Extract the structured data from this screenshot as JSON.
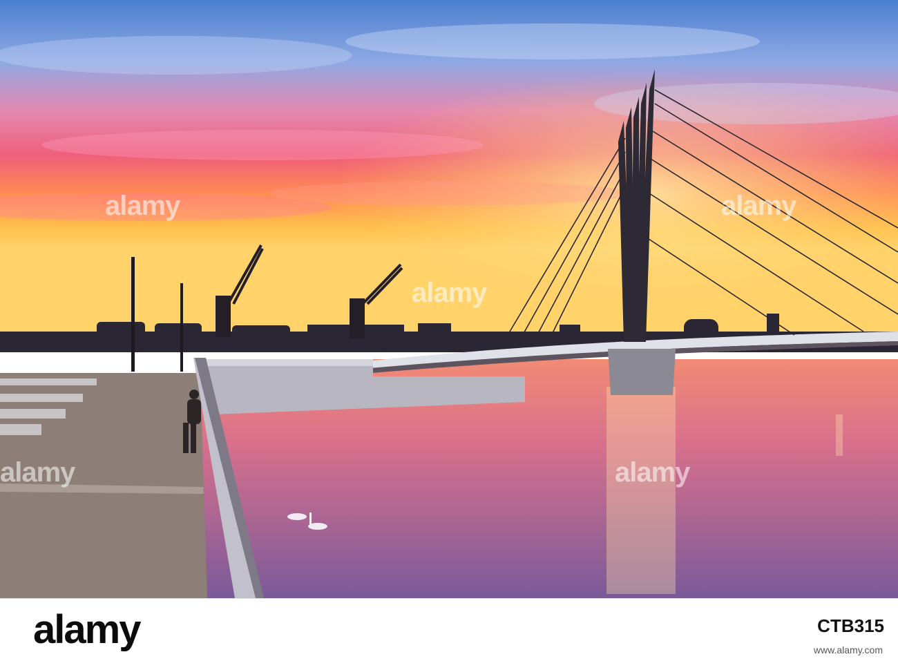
{
  "photo": {
    "subject": "",
    "colors": {
      "sky_top": "#5b8fd6",
      "sky_mid": "#e77aa0",
      "horizon": "#ffb347",
      "water": "#d77a92",
      "structure": "#2a2a2a"
    }
  },
  "watermark": {
    "text": "alamy"
  },
  "footer": {
    "brand": "alamy",
    "stock_label": "",
    "image_id": "CTB315",
    "site": "www.alamy.com"
  }
}
